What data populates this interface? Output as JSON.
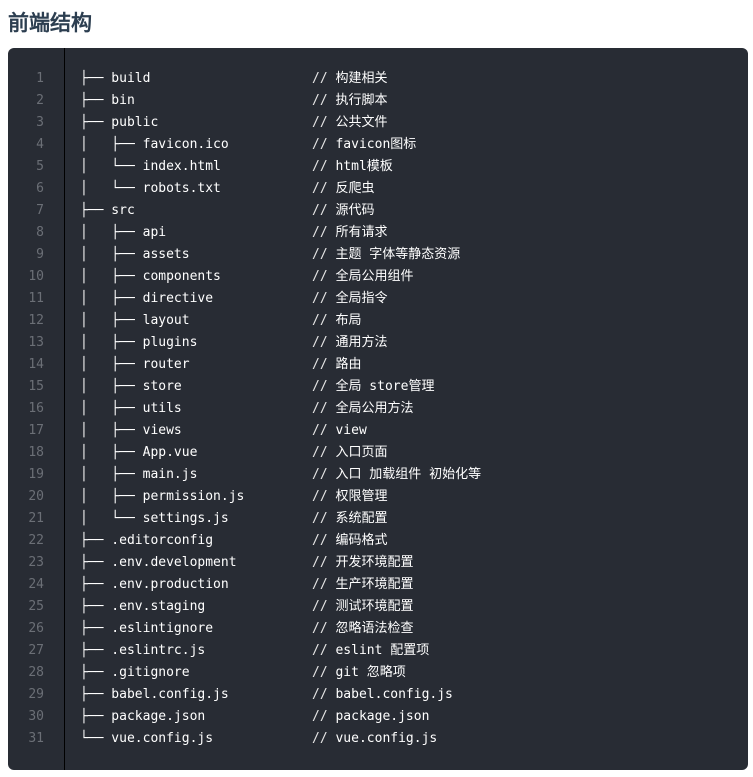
{
  "title": "前端结构",
  "lines": [
    {
      "n": "1",
      "tree": "├── build",
      "comment": "构建相关"
    },
    {
      "n": "2",
      "tree": "├── bin",
      "comment": "执行脚本"
    },
    {
      "n": "3",
      "tree": "├── public",
      "comment": "公共文件"
    },
    {
      "n": "4",
      "tree": "│   ├── favicon.ico",
      "comment": "favicon图标"
    },
    {
      "n": "5",
      "tree": "│   └── index.html",
      "comment": "html模板"
    },
    {
      "n": "6",
      "tree": "│   └── robots.txt",
      "comment": "反爬虫"
    },
    {
      "n": "7",
      "tree": "├── src",
      "comment": "源代码"
    },
    {
      "n": "8",
      "tree": "│   ├── api",
      "comment": "所有请求"
    },
    {
      "n": "9",
      "tree": "│   ├── assets",
      "comment": "主题 字体等静态资源"
    },
    {
      "n": "10",
      "tree": "│   ├── components",
      "comment": "全局公用组件"
    },
    {
      "n": "11",
      "tree": "│   ├── directive",
      "comment": "全局指令"
    },
    {
      "n": "12",
      "tree": "│   ├── layout",
      "comment": "布局"
    },
    {
      "n": "13",
      "tree": "│   ├── plugins",
      "comment": "通用方法"
    },
    {
      "n": "14",
      "tree": "│   ├── router",
      "comment": "路由"
    },
    {
      "n": "15",
      "tree": "│   ├── store",
      "comment": "全局 store管理"
    },
    {
      "n": "16",
      "tree": "│   ├── utils",
      "comment": "全局公用方法"
    },
    {
      "n": "17",
      "tree": "│   ├── views",
      "comment": "view"
    },
    {
      "n": "18",
      "tree": "│   ├── App.vue",
      "comment": "入口页面"
    },
    {
      "n": "19",
      "tree": "│   ├── main.js",
      "comment": "入口 加载组件 初始化等"
    },
    {
      "n": "20",
      "tree": "│   ├── permission.js",
      "comment": "权限管理"
    },
    {
      "n": "21",
      "tree": "│   └── settings.js",
      "comment": "系统配置"
    },
    {
      "n": "22",
      "tree": "├── .editorconfig",
      "comment": "编码格式"
    },
    {
      "n": "23",
      "tree": "├── .env.development",
      "comment": "开发环境配置"
    },
    {
      "n": "24",
      "tree": "├── .env.production",
      "comment": "生产环境配置"
    },
    {
      "n": "25",
      "tree": "├── .env.staging",
      "comment": "测试环境配置"
    },
    {
      "n": "26",
      "tree": "├── .eslintignore",
      "comment": "忽略语法检查"
    },
    {
      "n": "27",
      "tree": "├── .eslintrc.js",
      "comment": "eslint 配置项"
    },
    {
      "n": "28",
      "tree": "├── .gitignore",
      "comment": "git 忽略项"
    },
    {
      "n": "29",
      "tree": "├── babel.config.js",
      "comment": "babel.config.js"
    },
    {
      "n": "30",
      "tree": "├── package.json",
      "comment": "package.json"
    },
    {
      "n": "31",
      "tree": "└── vue.config.js",
      "comment": "vue.config.js"
    }
  ],
  "comment_prefix": "// ",
  "colors": {
    "code_background": "#282c34",
    "line_number": "#6b6f76",
    "code_text": "#ffffff"
  }
}
